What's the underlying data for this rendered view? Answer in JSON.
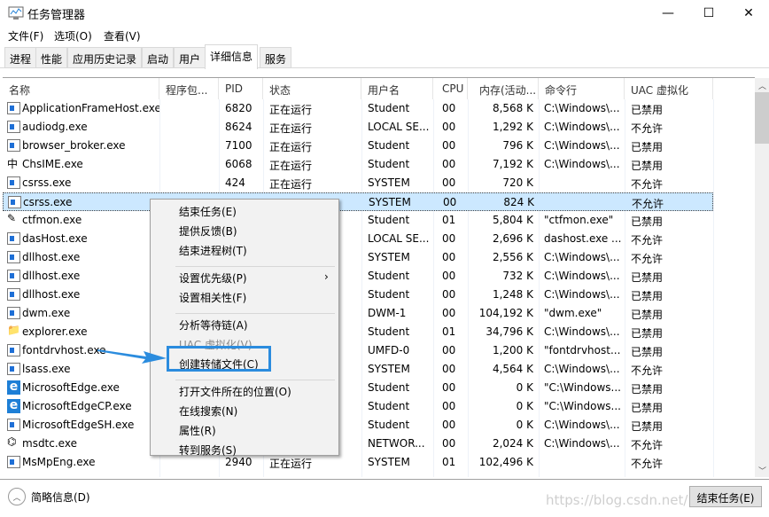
{
  "window": {
    "title": "任务管理器",
    "controls": [
      "minimize-icon",
      "maximize-icon",
      "close-icon"
    ]
  },
  "menubar": [
    "文件(F)",
    "选项(O)",
    "查看(V)"
  ],
  "tabs": [
    {
      "label": "进程"
    },
    {
      "label": "性能"
    },
    {
      "label": "应用历史记录"
    },
    {
      "label": "启动"
    },
    {
      "label": "用户"
    },
    {
      "label": "详细信息",
      "active": true
    },
    {
      "label": "服务"
    }
  ],
  "columns": [
    "名称",
    "程序包...",
    "PID",
    "状态",
    "用户名",
    "CPU",
    "内存(活动...",
    "命令行",
    "UAC 虚拟化"
  ],
  "rows": [
    {
      "icon": "window-icon",
      "name": "ApplicationFrameHost.exe",
      "pid": "6820",
      "status": "正在运行",
      "user": "Student",
      "cpu": "00",
      "mem": "8,568 K",
      "cmd": "C:\\Windows\\...",
      "uac": "已禁用"
    },
    {
      "icon": "window-icon",
      "name": "audiodg.exe",
      "pid": "8624",
      "status": "正在运行",
      "user": "LOCAL SE...",
      "cpu": "00",
      "mem": "1,292 K",
      "cmd": "C:\\Windows\\...",
      "uac": "不允许"
    },
    {
      "icon": "window-icon",
      "name": "browser_broker.exe",
      "pid": "7100",
      "status": "正在运行",
      "user": "Student",
      "cpu": "00",
      "mem": "796 K",
      "cmd": "C:\\Windows\\...",
      "uac": "已禁用"
    },
    {
      "icon": "ime-icon",
      "name": "ChsIME.exe",
      "pid": "6068",
      "status": "正在运行",
      "user": "Student",
      "cpu": "00",
      "mem": "7,192 K",
      "cmd": "C:\\Windows\\...",
      "uac": "已禁用"
    },
    {
      "icon": "window-icon",
      "name": "csrss.exe",
      "pid": "424",
      "status": "正在运行",
      "user": "SYSTEM",
      "cpu": "00",
      "mem": "720 K",
      "cmd": "",
      "uac": "不允许"
    },
    {
      "icon": "window-icon",
      "name": "csrss.exe",
      "pid": "",
      "status": "",
      "user": "SYSTEM",
      "cpu": "00",
      "mem": "824 K",
      "cmd": "",
      "uac": "不允许",
      "selected": true
    },
    {
      "icon": "pen-icon",
      "name": "ctfmon.exe",
      "pid": "",
      "status": "",
      "user": "Student",
      "cpu": "01",
      "mem": "5,804 K",
      "cmd": "\"ctfmon.exe\"",
      "uac": "已禁用"
    },
    {
      "icon": "window-icon",
      "name": "dasHost.exe",
      "pid": "",
      "status": "",
      "user": "LOCAL SE...",
      "cpu": "00",
      "mem": "2,696 K",
      "cmd": "dashost.exe ...",
      "uac": "不允许"
    },
    {
      "icon": "window-icon",
      "name": "dllhost.exe",
      "pid": "",
      "status": "",
      "user": "SYSTEM",
      "cpu": "00",
      "mem": "2,556 K",
      "cmd": "C:\\Windows\\...",
      "uac": "不允许"
    },
    {
      "icon": "window-icon",
      "name": "dllhost.exe",
      "pid": "",
      "status": "",
      "user": "Student",
      "cpu": "00",
      "mem": "732 K",
      "cmd": "C:\\Windows\\...",
      "uac": "已禁用"
    },
    {
      "icon": "window-icon",
      "name": "dllhost.exe",
      "pid": "",
      "status": "",
      "user": "Student",
      "cpu": "00",
      "mem": "1,248 K",
      "cmd": "C:\\Windows\\...",
      "uac": "已禁用"
    },
    {
      "icon": "window-icon",
      "name": "dwm.exe",
      "pid": "",
      "status": "",
      "user": "DWM-1",
      "cpu": "00",
      "mem": "104,192 K",
      "cmd": "\"dwm.exe\"",
      "uac": "已禁用"
    },
    {
      "icon": "folder-icon",
      "name": "explorer.exe",
      "pid": "",
      "status": "",
      "user": "Student",
      "cpu": "01",
      "mem": "34,796 K",
      "cmd": "C:\\Windows\\...",
      "uac": "已禁用"
    },
    {
      "icon": "window-icon",
      "name": "fontdrvhost.exe",
      "pid": "",
      "status": "",
      "user": "UMFD-0",
      "cpu": "00",
      "mem": "1,200 K",
      "cmd": "\"fontdrvhost...",
      "uac": "已禁用"
    },
    {
      "icon": "window-icon",
      "name": "lsass.exe",
      "pid": "",
      "status": "",
      "user": "SYSTEM",
      "cpu": "00",
      "mem": "4,564 K",
      "cmd": "C:\\Windows\\...",
      "uac": "不允许"
    },
    {
      "icon": "edge-icon",
      "name": "MicrosoftEdge.exe",
      "pid": "",
      "status": "",
      "user": "Student",
      "cpu": "00",
      "mem": "0 K",
      "cmd": "\"C:\\Windows...",
      "uac": "已禁用"
    },
    {
      "icon": "edge-icon",
      "name": "MicrosoftEdgeCP.exe",
      "pid": "",
      "status": "",
      "user": "Student",
      "cpu": "00",
      "mem": "0 K",
      "cmd": "\"C:\\Windows...",
      "uac": "已禁用"
    },
    {
      "icon": "window-icon",
      "name": "MicrosoftEdgeSH.exe",
      "pid": "",
      "status": "",
      "user": "Student",
      "cpu": "00",
      "mem": "0 K",
      "cmd": "C:\\Windows\\...",
      "uac": "已禁用"
    },
    {
      "icon": "network-icon",
      "name": "msdtc.exe",
      "pid": "",
      "status": "",
      "user": "NETWOR...",
      "cpu": "00",
      "mem": "2,024 K",
      "cmd": "C:\\Windows\\...",
      "uac": "不允许"
    },
    {
      "icon": "window-icon",
      "name": "MsMpEng.exe",
      "pid": "2940",
      "status": "正在运行",
      "user": "SYSTEM",
      "cpu": "01",
      "mem": "102,496 K",
      "cmd": "",
      "uac": "不允许"
    }
  ],
  "context_menu": {
    "groups": [
      [
        {
          "label": "结束任务(E)"
        },
        {
          "label": "提供反馈(B)"
        },
        {
          "label": "结束进程树(T)"
        }
      ],
      [
        {
          "label": "设置优先级(P)",
          "submenu": true
        },
        {
          "label": "设置相关性(F)"
        }
      ],
      [
        {
          "label": "分析等待链(A)"
        },
        {
          "label": "UAC 虚拟化(V)",
          "disabled": true
        },
        {
          "label": "创建转储文件(C)",
          "highlighted": true
        }
      ],
      [
        {
          "label": "打开文件所在的位置(O)"
        },
        {
          "label": "在线搜索(N)"
        },
        {
          "label": "属性(R)"
        },
        {
          "label": "转到服务(S)"
        }
      ]
    ]
  },
  "footer": {
    "fewer_details": "简略信息(D)",
    "end_task": "结束任务(E)",
    "watermark": "https://blog.csdn.net/..."
  },
  "colors": {
    "selection": "#cce8ff",
    "annotation": "#2b8cde"
  }
}
